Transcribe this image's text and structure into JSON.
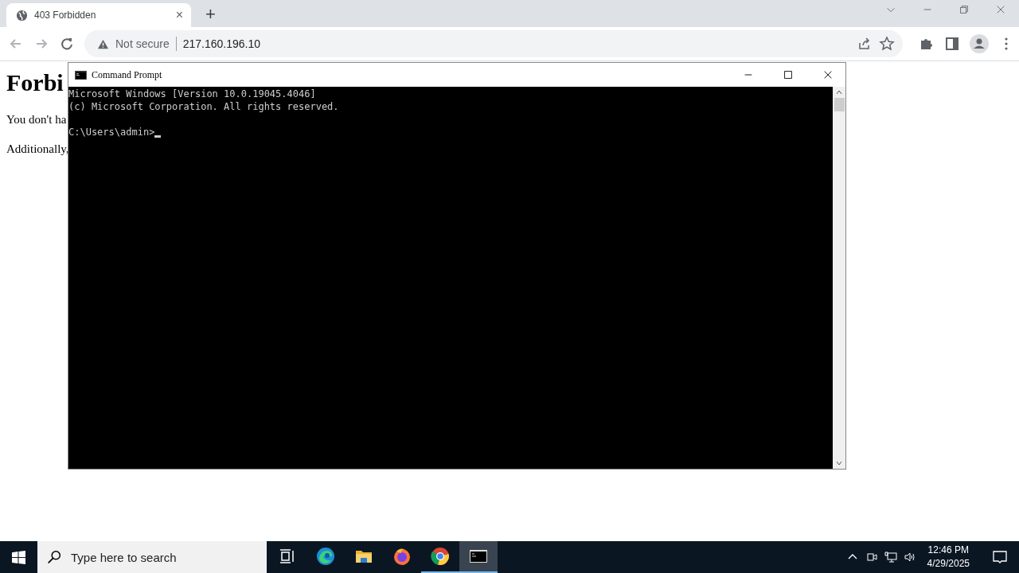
{
  "browser": {
    "tab": {
      "title": "403 Forbidden",
      "close": "×"
    },
    "new_tab": "+",
    "address": {
      "security": "Not secure",
      "url": "217.160.196.10"
    }
  },
  "page": {
    "heading": "Forbi",
    "paragraphs": [
      "You don't ha",
      "Additionally,"
    ]
  },
  "console_window": {
    "title": "Command Prompt",
    "lines": [
      "Microsoft Windows [Version 10.0.19045.4046]",
      "(c) Microsoft Corporation. All rights reserved."
    ],
    "prompt": "C:\\Users\\admin>"
  },
  "taskbar": {
    "search_placeholder": "Type here to search",
    "apps": [
      {
        "kind": "taskview",
        "running": false,
        "selected": false
      },
      {
        "kind": "edge",
        "running": false,
        "selected": false
      },
      {
        "kind": "explorer",
        "running": false,
        "selected": false
      },
      {
        "kind": "firefox",
        "running": false,
        "selected": false
      },
      {
        "kind": "chrome",
        "running": true,
        "selected": false
      },
      {
        "kind": "console",
        "running": true,
        "selected": true
      }
    ],
    "time": "12:46 PM",
    "date": "4/29/2025"
  }
}
